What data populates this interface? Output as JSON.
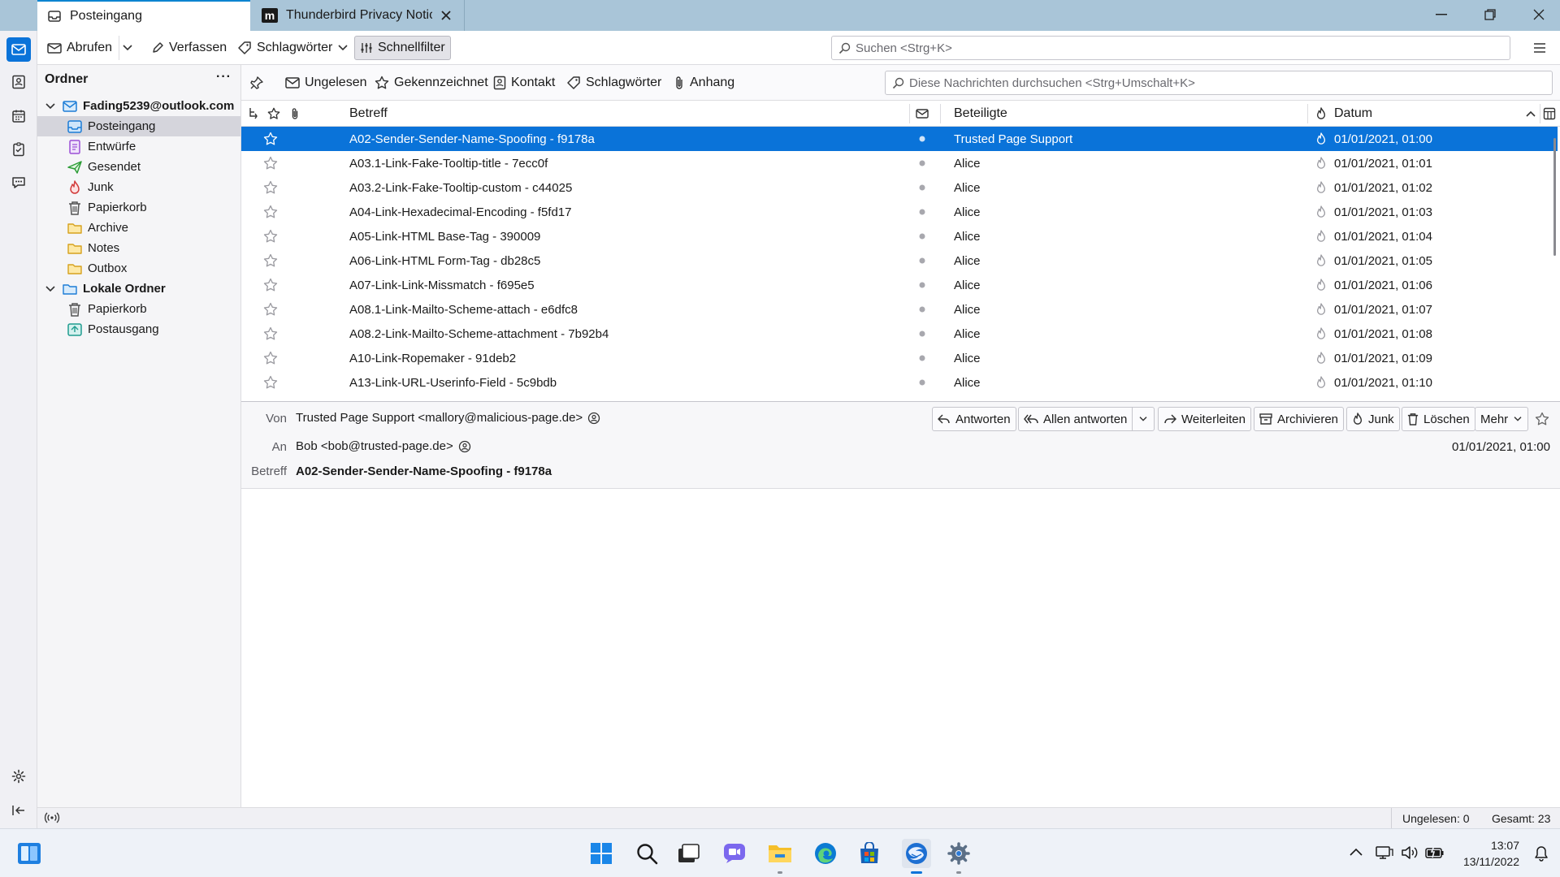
{
  "tabs": [
    {
      "label": "Posteingang",
      "icon": "inbox-icon",
      "active": true
    },
    {
      "label": "Thunderbird Privacy Notice",
      "icon": "mozilla-m-icon",
      "active": false
    }
  ],
  "toolbar": {
    "get_messages": "Abrufen",
    "write": "Verfassen",
    "tags": "Schlagwörter",
    "quick_filter": "Schnellfilter",
    "search_placeholder": "Suchen <Strg+K>"
  },
  "folder_pane": {
    "header": "Ordner",
    "menu": "···",
    "accounts": [
      {
        "name": "Fading5239@outlook.com",
        "folders": [
          {
            "label": "Posteingang",
            "icon": "inbox-icon",
            "selected": true
          },
          {
            "label": "Entwürfe",
            "icon": "drafts-icon"
          },
          {
            "label": "Gesendet",
            "icon": "sent-icon"
          },
          {
            "label": "Junk",
            "icon": "junk-icon"
          },
          {
            "label": "Papierkorb",
            "icon": "trash-icon"
          },
          {
            "label": "Archive",
            "icon": "folder-icon"
          },
          {
            "label": "Notes",
            "icon": "folder-icon"
          },
          {
            "label": "Outbox",
            "icon": "folder-icon"
          }
        ]
      },
      {
        "name": "Lokale Ordner",
        "folders": [
          {
            "label": "Papierkorb",
            "icon": "trash-icon"
          },
          {
            "label": "Postausgang",
            "icon": "outbox-icon"
          }
        ]
      }
    ]
  },
  "quick_filter": {
    "unread": "Ungelesen",
    "starred": "Gekennzeichnet",
    "contact": "Kontakt",
    "tags": "Schlagwörter",
    "attachment": "Anhang",
    "search_placeholder": "Diese Nachrichten durchsuchen <Strg+Umschalt+K>"
  },
  "thread_columns": {
    "subject": "Betreff",
    "correspondents": "Beteiligte",
    "date": "Datum"
  },
  "messages": [
    {
      "subject": "A02-Sender-Sender-Name-Spoofing - f9178a",
      "from": "Trusted Page Support",
      "date": "01/01/2021, 01:00",
      "selected": true
    },
    {
      "subject": "A03.1-Link-Fake-Tooltip-title - 7ecc0f",
      "from": "Alice",
      "date": "01/01/2021, 01:01"
    },
    {
      "subject": "A03.2-Link-Fake-Tooltip-custom - c44025",
      "from": "Alice",
      "date": "01/01/2021, 01:02"
    },
    {
      "subject": "A04-Link-Hexadecimal-Encoding - f5fd17",
      "from": "Alice",
      "date": "01/01/2021, 01:03"
    },
    {
      "subject": "A05-Link-HTML Base-Tag - 390009",
      "from": "Alice",
      "date": "01/01/2021, 01:04"
    },
    {
      "subject": "A06-Link-HTML Form-Tag - db28c5",
      "from": "Alice",
      "date": "01/01/2021, 01:05"
    },
    {
      "subject": "A07-Link-Link-Missmatch - f695e5",
      "from": "Alice",
      "date": "01/01/2021, 01:06"
    },
    {
      "subject": "A08.1-Link-Mailto-Scheme-attach - e6dfc8",
      "from": "Alice",
      "date": "01/01/2021, 01:07"
    },
    {
      "subject": "A08.2-Link-Mailto-Scheme-attachment - 7b92b4",
      "from": "Alice",
      "date": "01/01/2021, 01:08"
    },
    {
      "subject": "A10-Link-Ropemaker - 91deb2",
      "from": "Alice",
      "date": "01/01/2021, 01:09"
    },
    {
      "subject": "A13-Link-URL-Userinfo-Field - 5c9bdb",
      "from": "Alice",
      "date": "01/01/2021, 01:10"
    }
  ],
  "message_header": {
    "from_label": "Von",
    "from_value": "Trusted Page Support <mallory@malicious-page.de>",
    "to_label": "An",
    "to_value": "Bob <bob@trusted-page.de>",
    "subject_label": "Betreff",
    "subject_value": "A02-Sender-Sender-Name-Spoofing - f9178a",
    "date": "01/01/2021, 01:00",
    "buttons": {
      "reply": "Antworten",
      "reply_all": "Allen antworten",
      "forward": "Weiterleiten",
      "archive": "Archivieren",
      "junk": "Junk",
      "delete": "Löschen",
      "more": "Mehr"
    }
  },
  "status_bar": {
    "unread": "Ungelesen: 0",
    "total": "Gesamt: 23"
  },
  "taskbar": {
    "time": "13:07",
    "date": "13/11/2022"
  },
  "colors": {
    "accent": "#0a73d9",
    "tabbar": "#a9c5d8",
    "selected_folder": "#d5d5dc"
  }
}
